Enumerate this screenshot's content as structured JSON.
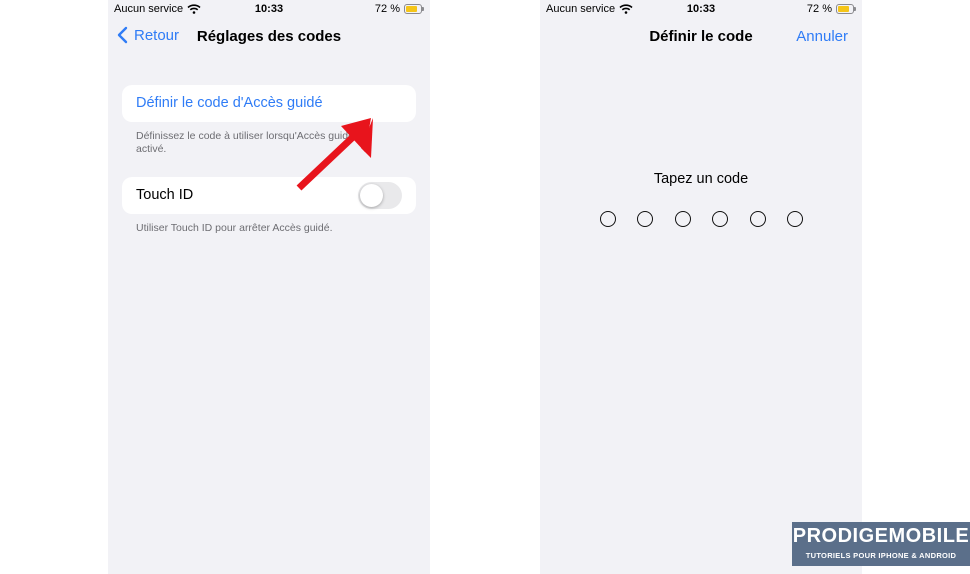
{
  "left_screen": {
    "status": {
      "carrier": "Aucun service",
      "time": "10:33",
      "battery": "72 %",
      "battery_level": 0.72
    },
    "nav": {
      "back_label": "Retour",
      "title": "Réglages des codes"
    },
    "define_code": {
      "label": "Définir le code d'Accès guidé",
      "footnote": "Définissez le code à utiliser lorsqu'Accès guidé est activé."
    },
    "touch_id": {
      "label": "Touch ID",
      "enabled": false,
      "footnote": "Utiliser Touch ID pour arrêter Accès guidé."
    }
  },
  "right_screen": {
    "status": {
      "carrier": "Aucun service",
      "time": "10:33",
      "battery": "72 %",
      "battery_level": 0.72
    },
    "nav": {
      "title": "Définir le code",
      "action_label": "Annuler"
    },
    "prompt": "Tapez un code",
    "code_length": 6
  },
  "watermark": {
    "brand": "PRODIGEMOBILE",
    "tagline": "TUTORIELS POUR IPHONE & ANDROID"
  },
  "colors": {
    "accent": "#2f7cf6",
    "background": "#f2f2f6",
    "arrow": "#e8141c",
    "battery": "#f5c518",
    "watermark_bg": "#5b6f8a"
  },
  "icons": [
    "wifi-icon",
    "battery-icon",
    "chevron-left-icon",
    "red-arrow-annotation"
  ]
}
